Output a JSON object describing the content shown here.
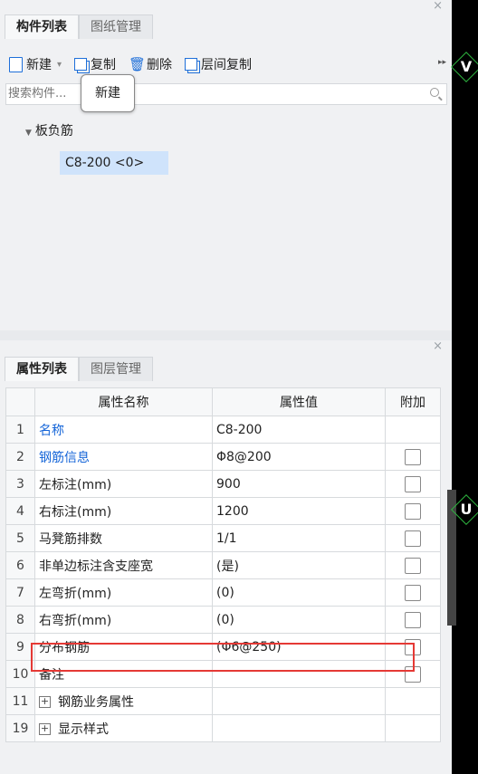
{
  "top_panel": {
    "close": "×",
    "tabs": [
      {
        "label": "构件列表",
        "active": true
      },
      {
        "label": "图纸管理",
        "active": false
      }
    ],
    "toolbar": {
      "new_label": "新建",
      "copy_label": "复制",
      "delete_label": "删除",
      "floor_copy_label": "层间复制",
      "more": "▸▸"
    },
    "search": {
      "placeholder": "搜索构件..."
    },
    "tooltip": "新建",
    "tree": {
      "root": "板负筋",
      "items": [
        "C8-200 <0>"
      ]
    }
  },
  "bottom_panel": {
    "close": "×",
    "tabs": [
      {
        "label": "属性列表",
        "active": true
      },
      {
        "label": "图层管理",
        "active": false
      }
    ],
    "headers": {
      "name": "属性名称",
      "value": "属性值",
      "extra": "附加"
    },
    "rows": [
      {
        "num": "1",
        "name": "名称",
        "value": "C8-200",
        "blue": true,
        "checkbox": false
      },
      {
        "num": "2",
        "name": "钢筋信息",
        "value": "Φ8@200",
        "blue": true,
        "checkbox": true
      },
      {
        "num": "3",
        "name": "左标注(mm)",
        "value": "900",
        "checkbox": true
      },
      {
        "num": "4",
        "name": "右标注(mm)",
        "value": "1200",
        "checkbox": true
      },
      {
        "num": "5",
        "name": "马凳筋排数",
        "value": "1/1",
        "checkbox": true
      },
      {
        "num": "6",
        "name": "非单边标注含支座宽",
        "value": "(是)",
        "checkbox": true
      },
      {
        "num": "7",
        "name": "左弯折(mm)",
        "value": "(0)",
        "checkbox": true
      },
      {
        "num": "8",
        "name": "右弯折(mm)",
        "value": "(0)",
        "checkbox": true
      },
      {
        "num": "9",
        "name": "分布钢筋",
        "value": "(Φ6@250)",
        "checkbox": true
      },
      {
        "num": "10",
        "name": "备注",
        "value": "",
        "checkbox": true
      },
      {
        "num": "11",
        "name": "钢筋业务属性",
        "value": "",
        "group": true
      },
      {
        "num": "19",
        "name": "显示样式",
        "value": "",
        "group": true
      }
    ]
  },
  "side_marks": [
    "V",
    "U"
  ],
  "colors": {
    "accent": "#1565d8",
    "highlight_box": "#e53935",
    "selected_item": "#cfe3fb",
    "marker": "#2db33e"
  }
}
